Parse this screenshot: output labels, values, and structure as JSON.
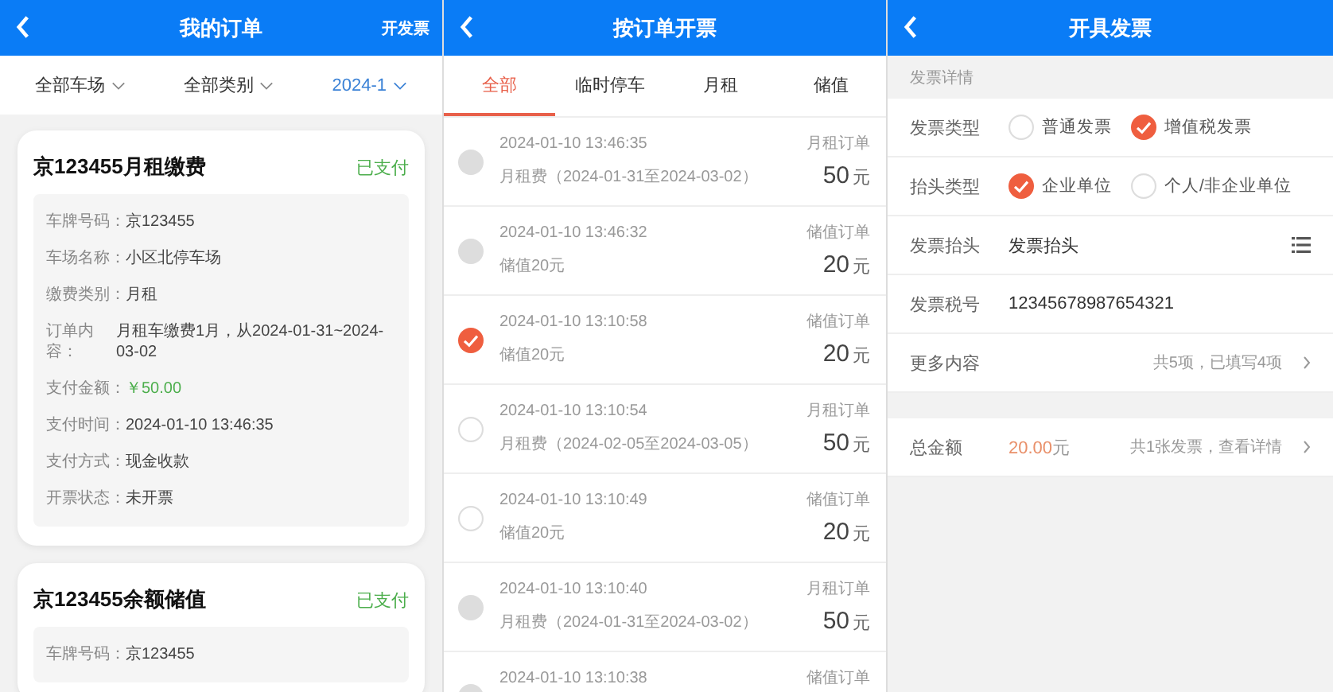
{
  "my_orders": {
    "title": "我的订单",
    "action": "开发票",
    "filters": [
      {
        "label": "全部车场",
        "selected": false
      },
      {
        "label": "全部类别",
        "selected": false
      },
      {
        "label": "2024-1",
        "selected": true
      }
    ],
    "cards": [
      {
        "title": "京123455月租缴费",
        "status": "已支付",
        "fields": [
          {
            "kind": "text",
            "label": "车牌号码：",
            "value": "京123455"
          },
          {
            "kind": "text",
            "label": "车场名称：",
            "value": "小区北停车场"
          },
          {
            "kind": "text",
            "label": "缴费类别：",
            "value": "月租"
          },
          {
            "kind": "long",
            "label": "订单内容：",
            "value": "月租车缴费1月，从2024-01-31~2024-03-02"
          },
          {
            "kind": "amount",
            "label": "支付金额：",
            "value": "￥50.00"
          },
          {
            "kind": "text",
            "label": "支付时间：",
            "value": "2024-01-10 13:46:35"
          },
          {
            "kind": "text",
            "label": "支付方式：",
            "value": "现金收款"
          },
          {
            "kind": "text",
            "label": "开票状态：",
            "value": "未开票"
          }
        ]
      },
      {
        "title": "京123455余额储值",
        "status": "已支付",
        "fields": [
          {
            "kind": "text",
            "label": "车牌号码：",
            "value": "京123455"
          }
        ]
      }
    ]
  },
  "invoice_by_order": {
    "title": "按订单开票",
    "tabs": [
      {
        "label": "全部",
        "selected": true
      },
      {
        "label": "临时停车",
        "selected": false
      },
      {
        "label": "月租",
        "selected": false
      },
      {
        "label": "储值",
        "selected": false
      }
    ],
    "orders": [
      {
        "time": "2024-01-10 13:46:35",
        "description": "月租费（2024-01-31至2024-03-02）",
        "type": "月租订单",
        "amount": "50",
        "unit": "元",
        "selected": false,
        "disabled": true
      },
      {
        "time": "2024-01-10 13:46:32",
        "description": "储值20元",
        "type": "储值订单",
        "amount": "20",
        "unit": "元",
        "selected": false,
        "disabled": true
      },
      {
        "time": "2024-01-10 13:10:58",
        "description": "储值20元",
        "type": "储值订单",
        "amount": "20",
        "unit": "元",
        "selected": true,
        "disabled": false
      },
      {
        "time": "2024-01-10 13:10:54",
        "description": "月租费（2024-02-05至2024-03-05）",
        "type": "月租订单",
        "amount": "50",
        "unit": "元",
        "selected": false,
        "disabled": false
      },
      {
        "time": "2024-01-10 13:10:49",
        "description": "储值20元",
        "type": "储值订单",
        "amount": "20",
        "unit": "元",
        "selected": false,
        "disabled": false
      },
      {
        "time": "2024-01-10 13:10:40",
        "description": "月租费（2024-01-31至2024-03-02）",
        "type": "月租订单",
        "amount": "50",
        "unit": "元",
        "selected": false,
        "disabled": true
      },
      {
        "time": "2024-01-10 13:10:38",
        "type": "储值订单",
        "selected": false,
        "disabled": true
      }
    ]
  },
  "issue_invoice": {
    "title": "开具发票",
    "section_title": "发票详情",
    "rows": [
      {
        "kind": "radio",
        "label": "发票类型",
        "options": [
          {
            "label": "普通发票",
            "selected": false
          },
          {
            "label": "增值税发票",
            "selected": true
          }
        ]
      },
      {
        "kind": "radio",
        "label": "抬头类型",
        "options": [
          {
            "label": "企业单位",
            "selected": true
          },
          {
            "label": "个人/非企业单位",
            "selected": false
          }
        ]
      },
      {
        "kind": "picker",
        "label": "发票抬头",
        "value": "发票抬头"
      },
      {
        "kind": "text",
        "label": "发票税号",
        "value": "12345678987654321"
      },
      {
        "kind": "link",
        "label": "更多内容",
        "value": "共5项，已填写4项"
      }
    ],
    "total": {
      "label": "总金额",
      "amount": "20.00",
      "unit": "元",
      "link": "共1张发票，查看详情"
    }
  }
}
